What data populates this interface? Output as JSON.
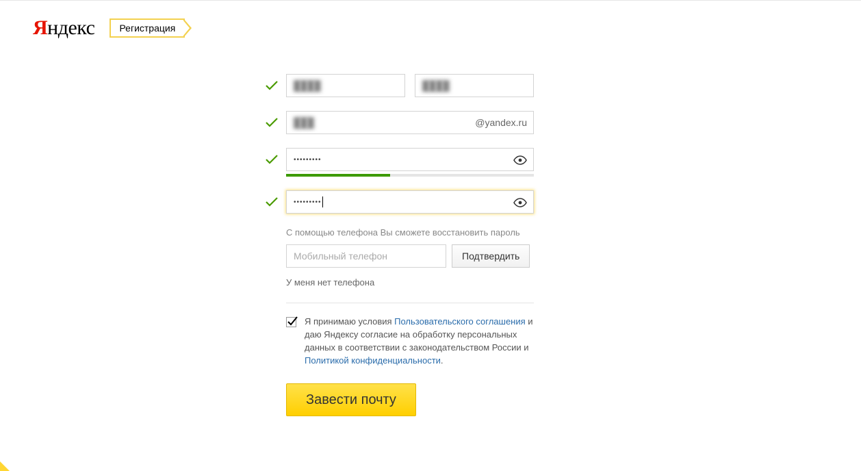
{
  "header": {
    "logo_prefix": "Я",
    "logo_rest": "ндекс",
    "badge": "Регистрация"
  },
  "form": {
    "first_name": "████",
    "last_name": "████",
    "login": "███",
    "email_suffix": "@yandex.ru",
    "password": "•••••••••",
    "password_confirm": "•••••••••",
    "password_strength_pct": 42,
    "phone_hint": "С помощью телефона Вы сможете восстановить пароль",
    "phone_placeholder": "Мобильный телефон",
    "confirm_button": "Подтвердить",
    "no_phone_link": "У меня нет телефона",
    "terms": {
      "checked": true,
      "text_1": "Я принимаю условия ",
      "link_1": "Пользовательского соглашения",
      "text_2": " и даю Яндексу согласие на обработку персональных данных в соответствии с законодательством России и ",
      "link_2": "Политикой конфиденциальности",
      "text_3": "."
    },
    "submit_button": "Завести почту"
  }
}
